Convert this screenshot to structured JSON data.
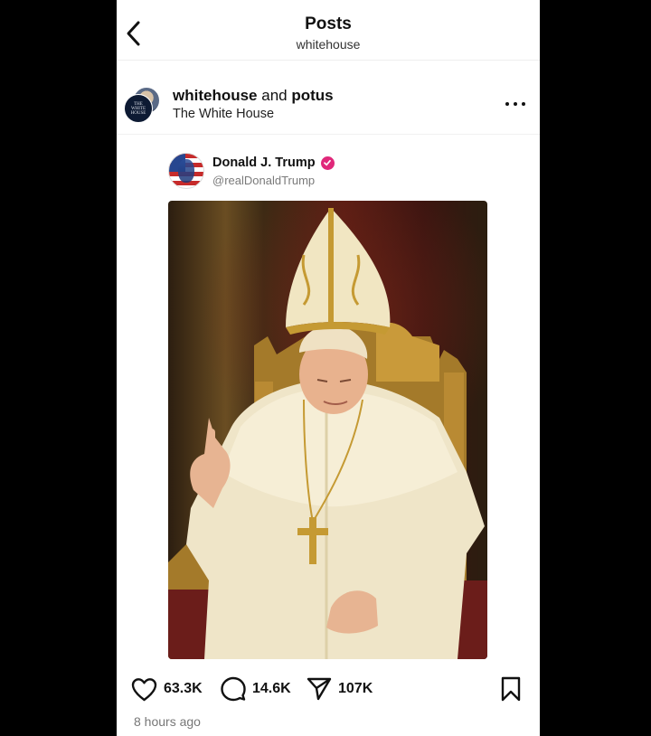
{
  "header": {
    "title": "Posts",
    "subtitle": "whitehouse",
    "back_icon": "chevron-left-icon"
  },
  "post": {
    "author_primary": "whitehouse",
    "author_connector": "and",
    "author_secondary": "potus",
    "org_name": "The White House",
    "avatar_text": "THE WHITE HOUSE",
    "more_icon": "ellipsis-icon"
  },
  "quoted": {
    "name": "Donald J. Trump",
    "handle": "@realDonaldTrump",
    "verified": true,
    "badge_color": "#e0287a"
  },
  "actions": {
    "likes": "63.3K",
    "replies": "14.6K",
    "shares": "107K"
  },
  "timestamp": "8 hours ago"
}
